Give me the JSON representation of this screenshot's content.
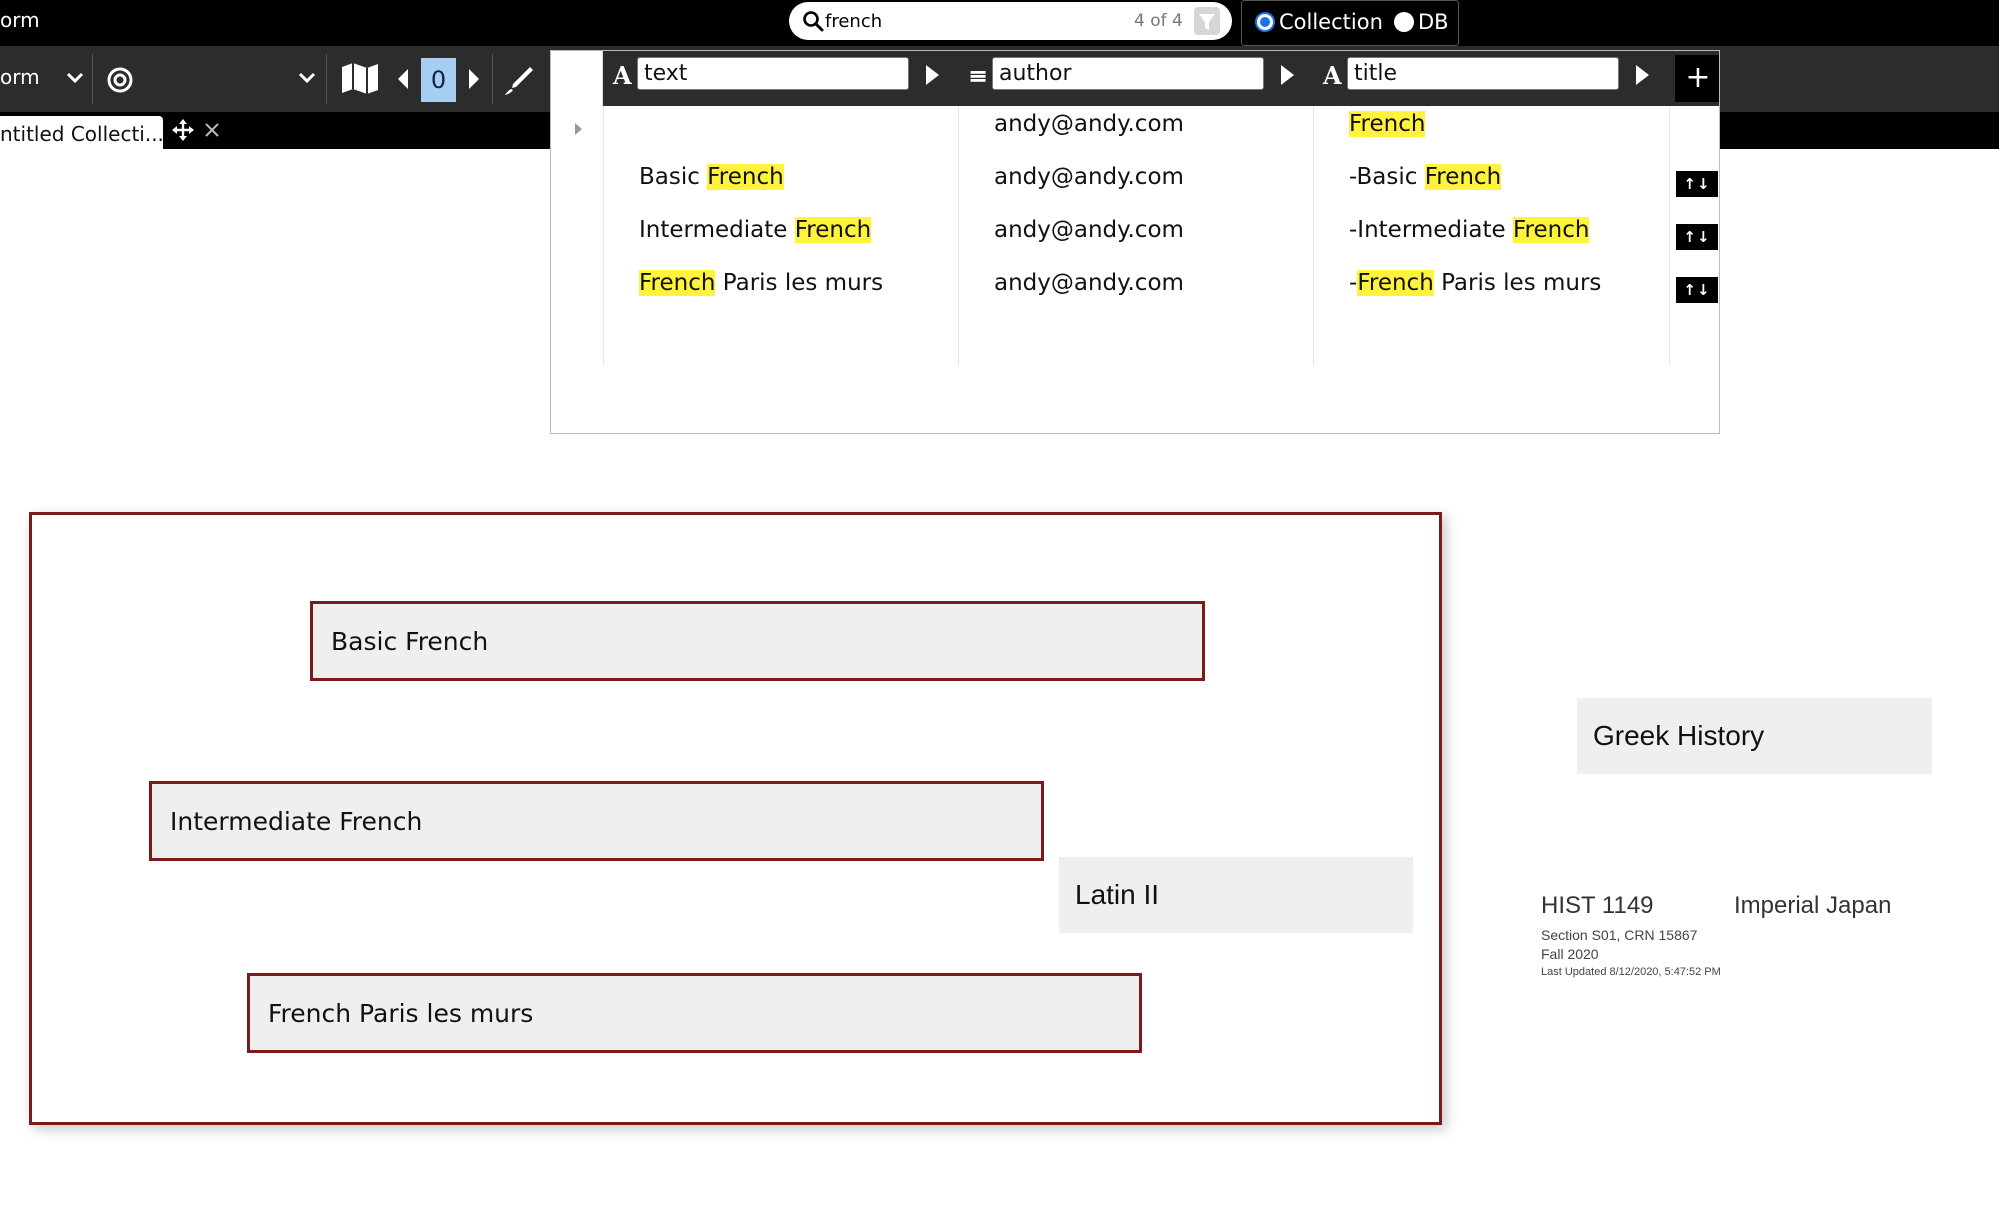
{
  "topbar": {
    "left_label": "orm",
    "search": {
      "value": "french",
      "count": "4 of 4"
    },
    "scope": {
      "collection_label": "Collection",
      "db_label": "DB",
      "selected": "Collection"
    }
  },
  "toolbar": {
    "mode_label": "orm",
    "counter_value": "0"
  },
  "tabs": [
    {
      "title": "ntitled Collecti..."
    }
  ],
  "schema_table": {
    "columns": [
      {
        "type_icon": "A",
        "name": "text"
      },
      {
        "type_icon": "≡",
        "name": "author"
      },
      {
        "type_icon": "A",
        "name": "title"
      }
    ],
    "add_label": "+",
    "move_label": "↑↓",
    "rows": [
      {
        "text_pre": "",
        "text_hl": "",
        "text_post": "",
        "author": "andy@andy.com",
        "title_pre": "",
        "title_hl": "French",
        "title_post": ""
      },
      {
        "text_pre": "Basic ",
        "text_hl": "French",
        "text_post": "",
        "author": "andy@andy.com",
        "title_pre": "-Basic ",
        "title_hl": "French",
        "title_post": ""
      },
      {
        "text_pre": "Intermediate ",
        "text_hl": "French",
        "text_post": "",
        "author": "andy@andy.com",
        "title_pre": "-Intermediate ",
        "title_hl": "French",
        "title_post": ""
      },
      {
        "text_pre": "",
        "text_hl": "French",
        "text_post": " Paris les murs",
        "author": "andy@andy.com",
        "title_pre": "-",
        "title_hl": "French",
        "title_post": " Paris les murs"
      }
    ]
  },
  "canvas": {
    "collection_docs": [
      "Basic French",
      "Intermediate French",
      "French Paris les murs"
    ],
    "free_docs": [
      "Latin II",
      "Greek History"
    ],
    "course_card": {
      "code": "HIST 1149",
      "name": "Imperial Japan",
      "section": "Section S01, CRN 15867",
      "term": "Fall 2020",
      "updated": "Last Updated 8/12/2020, 5:47:52 PM"
    }
  },
  "colors": {
    "highlight": "#fff33b",
    "frame_border": "#7a1a1a",
    "accent": "#1a73e8",
    "counter_bg": "#a6cdf2"
  }
}
